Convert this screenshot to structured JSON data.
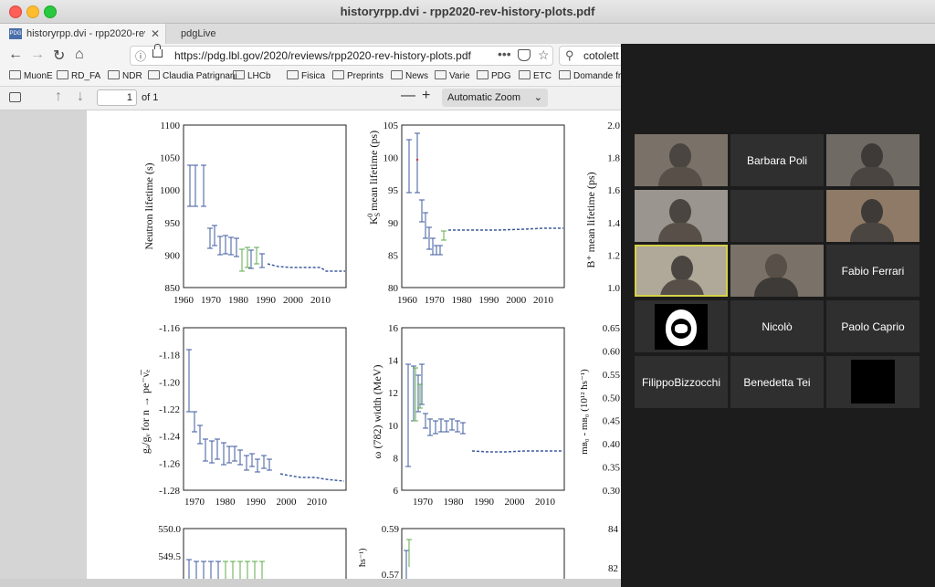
{
  "window": {
    "title": "historyrpp.dvi - rpp2020-rev-history-plots.pdf"
  },
  "tabs": [
    {
      "label": "historyrpp.dvi - rpp2020-rev-h",
      "favicon": "PDG",
      "active": true
    },
    {
      "label": "pdgLive",
      "active": false
    }
  ],
  "nav": {
    "url": "https://pdg.lbl.gov/2020/reviews/rpp2020-rev-history-plots.pdf",
    "search_value": "cotolett"
  },
  "bookmarks": [
    "MuonE",
    "RD_FA",
    "NDR",
    "Claudia Patrignani",
    "LHCb",
    "Fisica",
    "Preprints",
    "News",
    "Varie",
    "PDG",
    "ETC",
    "Domande fr"
  ],
  "pdf_toolbar": {
    "page_value": "1",
    "of_pages": "of 1",
    "zoom": "Automatic Zoom"
  },
  "charts": {
    "neutron": {
      "ylabel": "Neutron lifetime (s)",
      "yticks": [
        "850",
        "900",
        "950",
        "1000",
        "1050",
        "1100"
      ],
      "xticks": [
        "1960",
        "1970",
        "1980",
        "1990",
        "2000",
        "2010"
      ]
    },
    "kaon": {
      "ylabel_main": "K",
      "ylabel_sub": "S",
      "ylabel_sup": "0",
      "ylabel_rest": " mean lifetime (ps)",
      "yticks": [
        "80",
        "85",
        "90",
        "95",
        "100",
        "105"
      ],
      "xticks": [
        "1960",
        "1970",
        "1980",
        "1990",
        "2000",
        "2010"
      ]
    },
    "bplus": {
      "ylabel": "B⁺ mean lifetime (ps)",
      "yticks": [
        "1.0",
        "1.2",
        "1.4",
        "1.6",
        "1.8",
        "2.0"
      ]
    },
    "ga": {
      "ylabel": "gₐ/gᵥ for n → pe⁻ν̅ₑ",
      "yticks": [
        "-1.28",
        "-1.26",
        "-1.24",
        "-1.22",
        "-1.20",
        "-1.18",
        "-1.16"
      ],
      "xticks": [
        "1970",
        "1980",
        "1990",
        "2000",
        "2010"
      ]
    },
    "omega": {
      "ylabel": "ω (782) width (MeV)",
      "yticks": [
        "6",
        "8",
        "10",
        "12",
        "14",
        "16"
      ],
      "xticks": [
        "1970",
        "1980",
        "1990",
        "2000",
        "2010"
      ]
    },
    "mb": {
      "ylabel": "mʙ₀ - mʙ₀ (10¹² ħs⁻¹)",
      "yticks": [
        "0.30",
        "0.35",
        "0.40",
        "0.45",
        "0.50",
        "0.55",
        "0.60",
        "0.65"
      ]
    },
    "row3a": {
      "ytick_top": "550.0",
      "ytick_next": "549.5"
    },
    "row3b": {
      "ytick_top": "0.59",
      "ytick_next": "0.57",
      "ylabel_fragment": "ħs⁻¹)"
    },
    "row3c": {
      "ytick_top": "84",
      "ytick_next": "82"
    }
  },
  "participants": [
    {
      "name": "",
      "type": "video"
    },
    {
      "name": "Barbara Poli",
      "type": "name"
    },
    {
      "name": "",
      "type": "video"
    },
    {
      "name": "",
      "type": "video"
    },
    {
      "name": "",
      "type": "empty"
    },
    {
      "name": "",
      "type": "video"
    },
    {
      "name": "",
      "type": "video",
      "speaking": true
    },
    {
      "name": "",
      "type": "video"
    },
    {
      "name": "Fabio Ferrari",
      "type": "name"
    },
    {
      "name": "",
      "type": "avatar"
    },
    {
      "name": "Nicolò",
      "type": "name"
    },
    {
      "name": "Paolo Caprio",
      "type": "name"
    },
    {
      "name": "FilippoBizzocchi",
      "type": "name"
    },
    {
      "name": "Benedetta Tei",
      "type": "name"
    },
    {
      "name": "",
      "type": "blank"
    }
  ],
  "colors": {
    "plot_blue": "#3d5a9e",
    "plot_green": "#5cab4a",
    "plot_red": "#c63a3a",
    "speaker_border": "#d8d24a"
  }
}
